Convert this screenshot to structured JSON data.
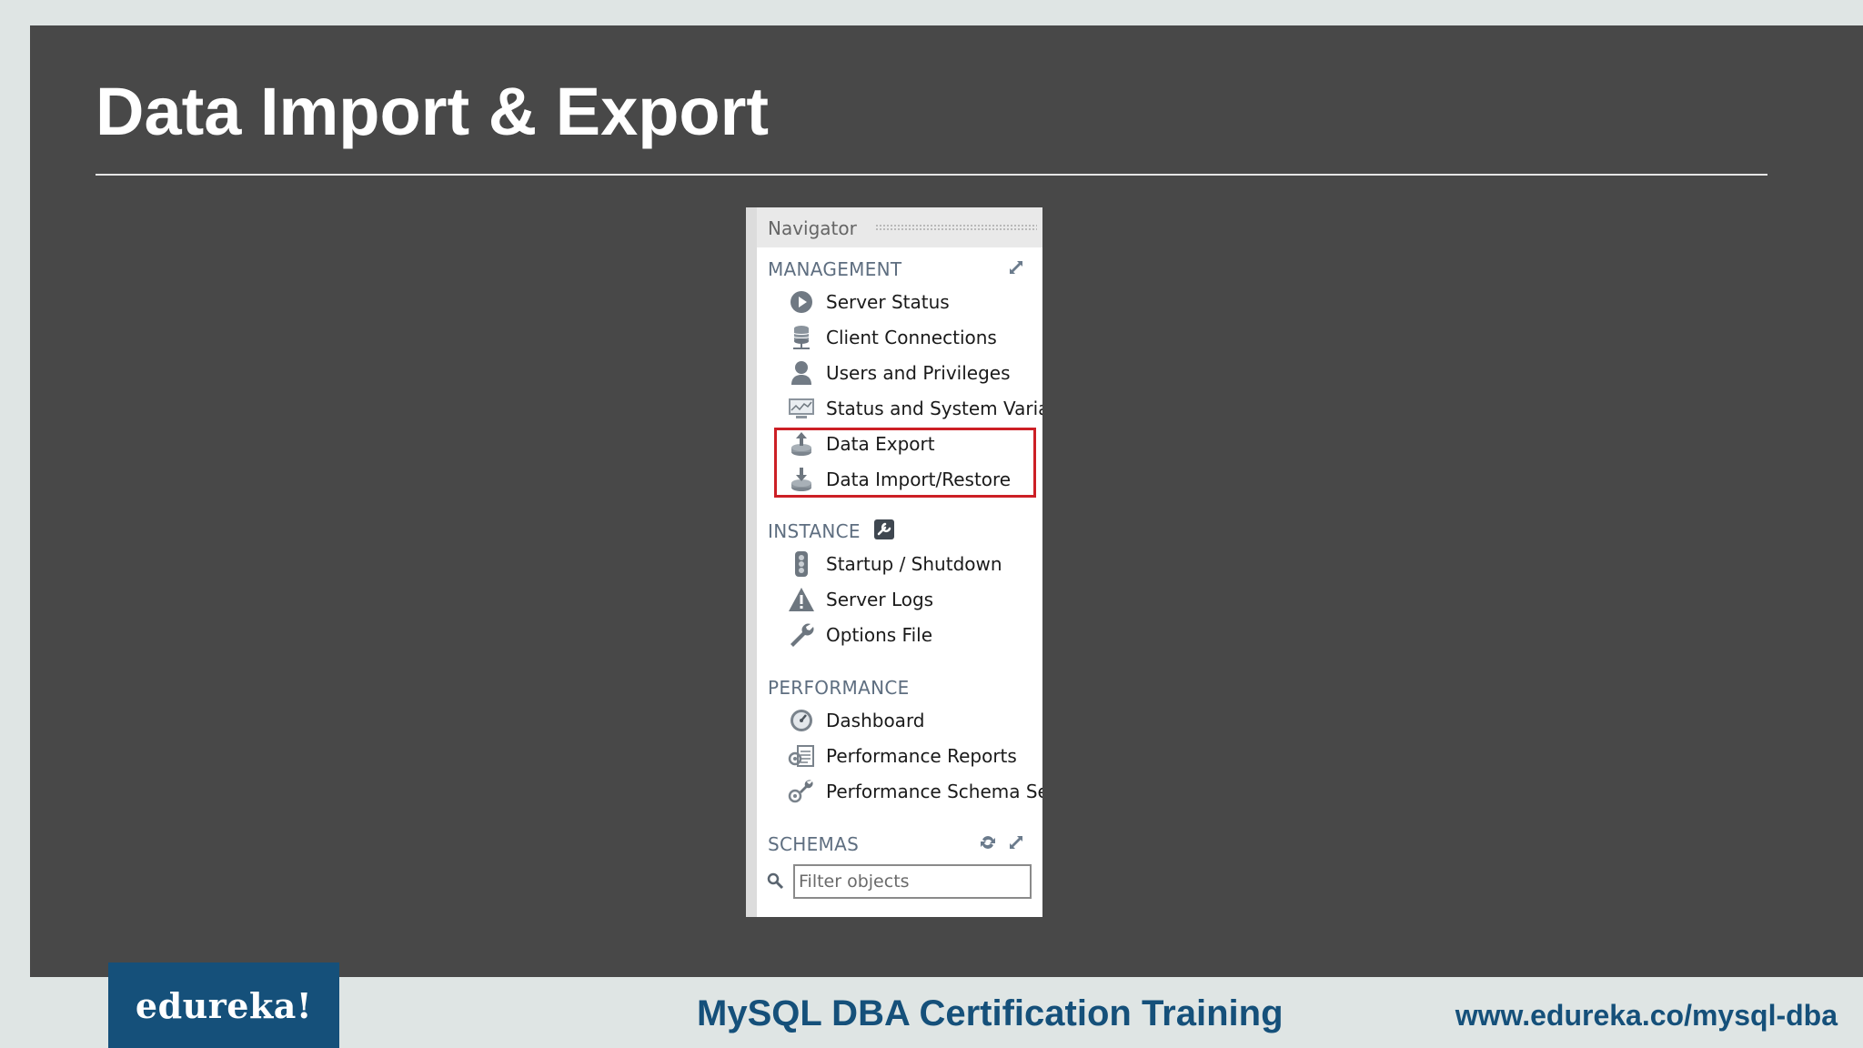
{
  "slide": {
    "title": "Data Import & Export"
  },
  "navigator": {
    "header": "Navigator",
    "sections": {
      "management": {
        "label": "MANAGEMENT",
        "items": [
          {
            "label": "Server Status",
            "icon": "play-circle-icon"
          },
          {
            "label": "Client Connections",
            "icon": "database-connections-icon"
          },
          {
            "label": "Users and Privileges",
            "icon": "user-icon"
          },
          {
            "label": "Status and System Varia",
            "icon": "monitor-chart-icon"
          },
          {
            "label": "Data Export",
            "icon": "upload-export-icon"
          },
          {
            "label": "Data Import/Restore",
            "icon": "download-import-icon"
          }
        ]
      },
      "instance": {
        "label": "INSTANCE",
        "items": [
          {
            "label": "Startup / Shutdown",
            "icon": "traffic-light-icon"
          },
          {
            "label": "Server Logs",
            "icon": "warning-icon"
          },
          {
            "label": "Options File",
            "icon": "wrench-icon"
          }
        ]
      },
      "performance": {
        "label": "PERFORMANCE",
        "items": [
          {
            "label": "Dashboard",
            "icon": "gauge-icon"
          },
          {
            "label": "Performance Reports",
            "icon": "reports-icon"
          },
          {
            "label": "Performance Schema Se",
            "icon": "schema-setup-icon"
          }
        ]
      },
      "schemas": {
        "label": "SCHEMAS",
        "filter_placeholder": "Filter objects"
      }
    }
  },
  "footer": {
    "logo": "edureka!",
    "course": "MySQL DBA Certification Training",
    "url": "www.edureka.co/mysql-dba"
  },
  "colors": {
    "slide_bg": "#484848",
    "page_bg": "#dfe5e4",
    "brand_blue": "#15507a",
    "highlight_red": "#cc1f25",
    "section_label": "#5e6e80"
  }
}
